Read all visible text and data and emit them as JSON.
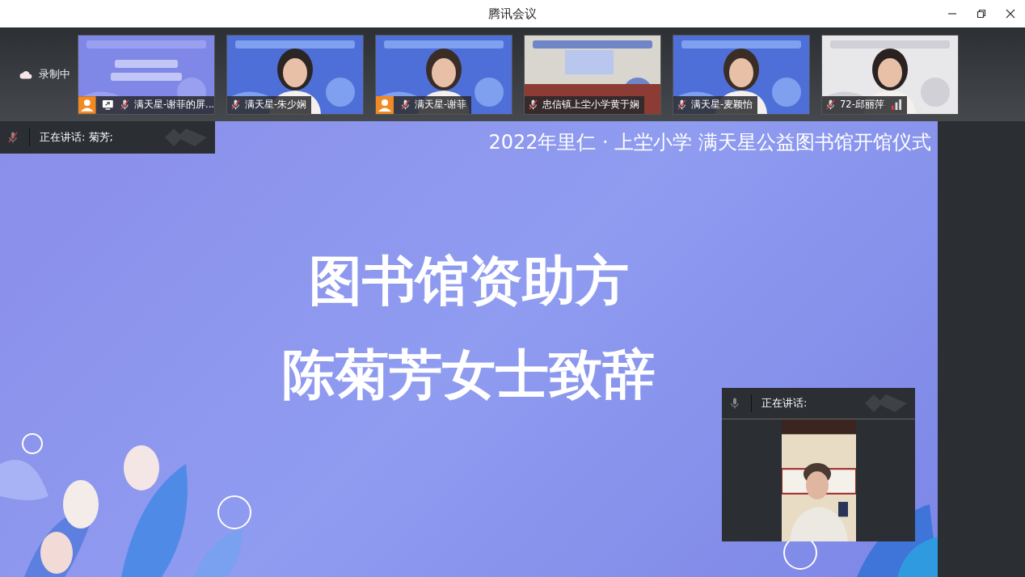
{
  "window": {
    "title": "腾讯会议"
  },
  "recording": {
    "label": "录制中"
  },
  "participants": [
    {
      "name": "满天星-谢菲的屏...",
      "muted": true,
      "avatar_badge": true,
      "sharing": true,
      "signal": false
    },
    {
      "name": "满天星-朱少娴",
      "muted": true,
      "avatar_badge": false,
      "sharing": false,
      "signal": false
    },
    {
      "name": "满天星-谢菲",
      "muted": true,
      "avatar_badge": true,
      "sharing": false,
      "signal": false
    },
    {
      "name": "忠信镇上坣小学黄于娴",
      "muted": true,
      "avatar_badge": false,
      "sharing": false,
      "signal": false
    },
    {
      "name": "满天星-麦颖怡",
      "muted": true,
      "avatar_badge": false,
      "sharing": false,
      "signal": false
    },
    {
      "name": "72-邱丽萍",
      "muted": true,
      "avatar_badge": false,
      "sharing": false,
      "signal": true
    }
  ],
  "speaker_bar": {
    "label": "正在讲话: 菊芳;",
    "muted": true
  },
  "slide": {
    "header": "2022年里仁 · 上坣小学 满天星公益图书馆开馆仪式",
    "lines": [
      "图书馆资助方",
      "陈菊芳女士致辞"
    ]
  },
  "floating_video": {
    "label": "正在讲话:",
    "muted": false
  }
}
